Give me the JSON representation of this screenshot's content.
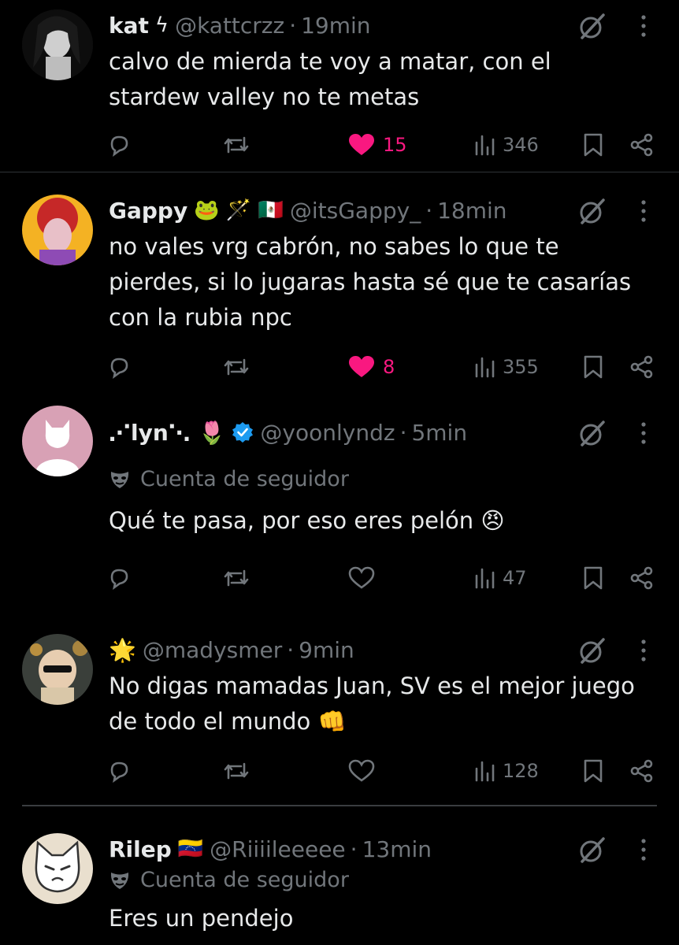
{
  "tweets": [
    {
      "name": "kat",
      "badge": "ϟ",
      "handle": "@kattcrzz",
      "sep": "·",
      "time": "19min",
      "lines": [
        "calvo de mierda te voy a matar, con el",
        "stardew valley no te metas"
      ],
      "likes": "15",
      "views": "346",
      "liked": true
    },
    {
      "name": "Gappy",
      "badge": "🐸 🪄 🇲🇽",
      "handle": "@itsGappy_",
      "sep": "·",
      "time": "18min",
      "lines": [
        "no vales vrg cabrón, no sabes lo que te",
        "pierdes, si lo jugaras hasta sé que te casarías",
        "con la rubia npc"
      ],
      "likes": "8",
      "views": "355",
      "liked": true
    },
    {
      "name": "⋰lyn⋱ 🌷",
      "handle": "@yoonlyndz",
      "sep": "·",
      "time": "5min",
      "follower_label": "Cuenta de seguidor",
      "lines": [
        "Qué te pasa, por eso eres pelón 😠"
      ],
      "likes": "",
      "views": "47",
      "liked": false
    },
    {
      "name": "🌟",
      "handle": "@madysmer",
      "sep": "·",
      "time": "9min",
      "lines": [
        "No digas mamadas Juan, SV es el mejor juego",
        "de todo el mundo 👊"
      ],
      "likes": "",
      "views": "128",
      "liked": false
    },
    {
      "name": "Rilep",
      "badge": "🇻🇪",
      "handle": "@Riiiileeeee",
      "sep": "·",
      "time": "13min",
      "follower_label": "Cuenta de seguidor",
      "lines": [
        "Eres un pendejo"
      ]
    }
  ],
  "colors": {
    "background": "#000000",
    "text": "#e7e9ea",
    "muted": "#71767b",
    "like": "#f91880",
    "verified": "#1d9bf0",
    "divider": "#2f3336"
  },
  "icons": [
    "reply-icon",
    "retweet-icon",
    "heart-icon",
    "views-icon",
    "bookmark-icon",
    "share-icon",
    "grok-icon",
    "more-icon",
    "mask-icon",
    "verified-icon"
  ]
}
